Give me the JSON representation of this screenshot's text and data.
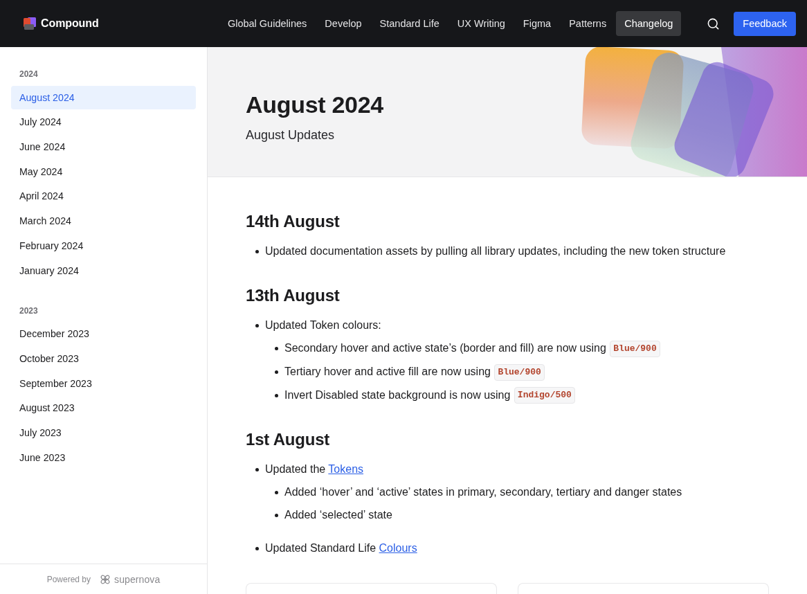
{
  "header": {
    "logo_text": "Compound",
    "nav": [
      {
        "label": "Global Guidelines",
        "selected": false
      },
      {
        "label": "Develop",
        "selected": false
      },
      {
        "label": "Standard Life",
        "selected": false
      },
      {
        "label": "UX Writing",
        "selected": false
      },
      {
        "label": "Figma",
        "selected": false
      },
      {
        "label": "Patterns",
        "selected": false
      },
      {
        "label": "Changelog",
        "selected": true
      }
    ],
    "feedback_button": "Feedback"
  },
  "sidebar": {
    "groups": [
      {
        "label": "2024",
        "items": [
          {
            "label": "August 2024",
            "selected": true
          },
          {
            "label": "July 2024",
            "selected": false
          },
          {
            "label": "June 2024",
            "selected": false
          },
          {
            "label": "May 2024",
            "selected": false
          },
          {
            "label": "April 2024",
            "selected": false
          },
          {
            "label": "March 2024",
            "selected": false
          },
          {
            "label": "February 2024",
            "selected": false
          },
          {
            "label": "January 2024",
            "selected": false
          }
        ]
      },
      {
        "label": "2023",
        "items": [
          {
            "label": "December 2023",
            "selected": false
          },
          {
            "label": "October 2023",
            "selected": false
          },
          {
            "label": "September 2023",
            "selected": false
          },
          {
            "label": "August 2023",
            "selected": false
          },
          {
            "label": "July 2023",
            "selected": false
          },
          {
            "label": "June 2023",
            "selected": false
          }
        ]
      }
    ],
    "footer": {
      "powered_by": "Powered by",
      "brand": "supernova"
    }
  },
  "hero": {
    "title": "August 2024",
    "subtitle": "August Updates"
  },
  "sections": [
    {
      "heading": "14th August",
      "items": [
        {
          "parts": [
            {
              "kind": "text",
              "text": "Updated documentation assets by pulling all library updates, including the new token structure"
            }
          ]
        }
      ]
    },
    {
      "heading": "13th August",
      "items": [
        {
          "parts": [
            {
              "kind": "text",
              "text": "Updated Token colours:"
            }
          ],
          "children": [
            {
              "parts": [
                {
                  "kind": "text",
                  "text": "Secondary hover and active state’s (border and fill) are now using "
                },
                {
                  "kind": "code",
                  "text": "Blue/900"
                }
              ]
            },
            {
              "parts": [
                {
                  "kind": "text",
                  "text": "Tertiary hover and active fill are now using "
                },
                {
                  "kind": "code",
                  "text": "Blue/900"
                }
              ]
            },
            {
              "parts": [
                {
                  "kind": "text",
                  "text": "Invert Disabled state background is now using "
                },
                {
                  "kind": "code",
                  "text": "Indigo/500"
                }
              ]
            }
          ]
        }
      ]
    },
    {
      "heading": "1st August",
      "items": [
        {
          "parts": [
            {
              "kind": "text",
              "text": "Updated the "
            },
            {
              "kind": "link",
              "text": "Tokens"
            }
          ],
          "children": [
            {
              "parts": [
                {
                  "kind": "text",
                  "text": "Added ‘hover’ and ‘active’ states in primary, secondary, tertiary and danger states"
                }
              ]
            },
            {
              "parts": [
                {
                  "kind": "text",
                  "text": "Added ‘selected’ state"
                }
              ]
            }
          ]
        },
        {
          "parts": [
            {
              "kind": "text",
              "text": "Updated Standard Life "
            },
            {
              "kind": "link",
              "text": "Colours"
            }
          ]
        }
      ]
    }
  ]
}
